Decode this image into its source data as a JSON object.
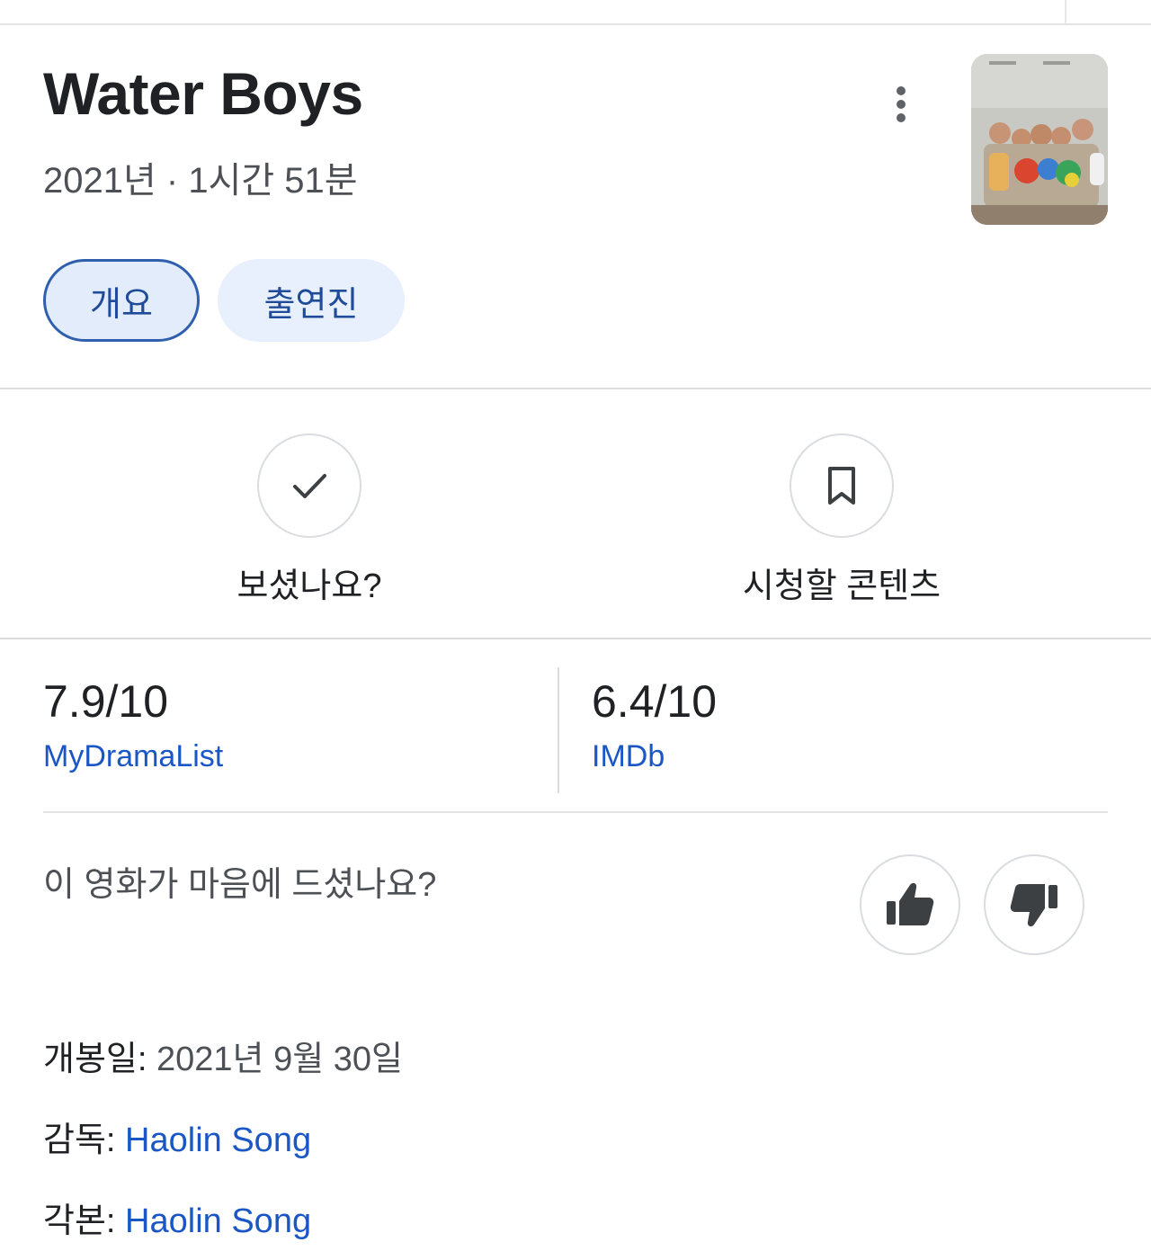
{
  "movie": {
    "title": "Water Boys",
    "meta": "2021년 · 1시간 51분",
    "poster_icon": "movie-poster-image"
  },
  "tabs": [
    {
      "label": "개요",
      "active": true
    },
    {
      "label": "출연진",
      "active": false
    }
  ],
  "actions": [
    {
      "label": "보셨나요?",
      "icon": "check-icon"
    },
    {
      "label": "시청할 콘텐츠",
      "icon": "bookmark-icon"
    }
  ],
  "ratings": [
    {
      "score": "7.9/10",
      "source": "MyDramaList"
    },
    {
      "score": "6.4/10",
      "source": "IMDb"
    }
  ],
  "feedback": {
    "question": "이 영화가 마음에 드셨나요?",
    "like_icon": "thumbs-up-icon",
    "dislike_icon": "thumbs-down-icon"
  },
  "details": {
    "release_label": "개봉일:",
    "release_value": "2021년 9월 30일",
    "director_label": "감독:",
    "director_value": "Haolin Song",
    "writer_label": "각본:",
    "writer_value": "Haolin Song"
  },
  "colors": {
    "link": "#1a56c6",
    "chip_bg": "#e8f0fe",
    "chip_border": "#2f5fad",
    "divider": "#dadce0"
  }
}
